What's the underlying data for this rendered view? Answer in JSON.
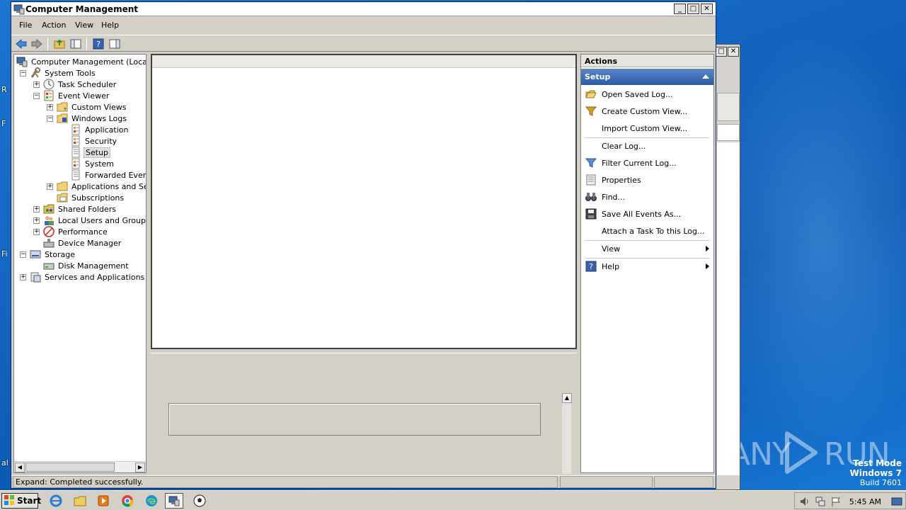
{
  "window": {
    "title": "Computer Management"
  },
  "menu": [
    "File",
    "Action",
    "View",
    "Help"
  ],
  "tree": {
    "items": [
      {
        "label": "Computer Management (Local)"
      },
      {
        "label": "System Tools"
      },
      {
        "label": "Task Scheduler"
      },
      {
        "label": "Event Viewer"
      },
      {
        "label": "Custom Views"
      },
      {
        "label": "Windows Logs"
      },
      {
        "label": "Application"
      },
      {
        "label": "Security"
      },
      {
        "label": "Setup"
      },
      {
        "label": "System"
      },
      {
        "label": "Forwarded Events"
      },
      {
        "label": "Applications and Servi"
      },
      {
        "label": "Subscriptions"
      },
      {
        "label": "Shared Folders"
      },
      {
        "label": "Local Users and Groups"
      },
      {
        "label": "Performance"
      },
      {
        "label": "Device Manager"
      },
      {
        "label": "Storage"
      },
      {
        "label": "Disk Management"
      },
      {
        "label": "Services and Applications"
      }
    ]
  },
  "actions": {
    "header": "Actions",
    "section": "Setup",
    "items": [
      {
        "label": "Open Saved Log..."
      },
      {
        "label": "Create Custom View..."
      },
      {
        "label": "Import Custom View..."
      },
      {
        "label": "Clear Log..."
      },
      {
        "label": "Filter Current Log..."
      },
      {
        "label": "Properties"
      },
      {
        "label": "Find..."
      },
      {
        "label": "Save All Events As..."
      },
      {
        "label": "Attach a Task To this Log..."
      },
      {
        "label": "View"
      },
      {
        "label": "Help"
      }
    ]
  },
  "status": {
    "text": "Expand:  Completed successfully."
  },
  "taskbar": {
    "start": "Start",
    "time": "5:45 AM"
  },
  "desktop": {
    "testmode": "Test Mode",
    "os": "Windows 7",
    "build": "Build 7601",
    "watermark_left": "ANY",
    "watermark_right": "RUN"
  }
}
